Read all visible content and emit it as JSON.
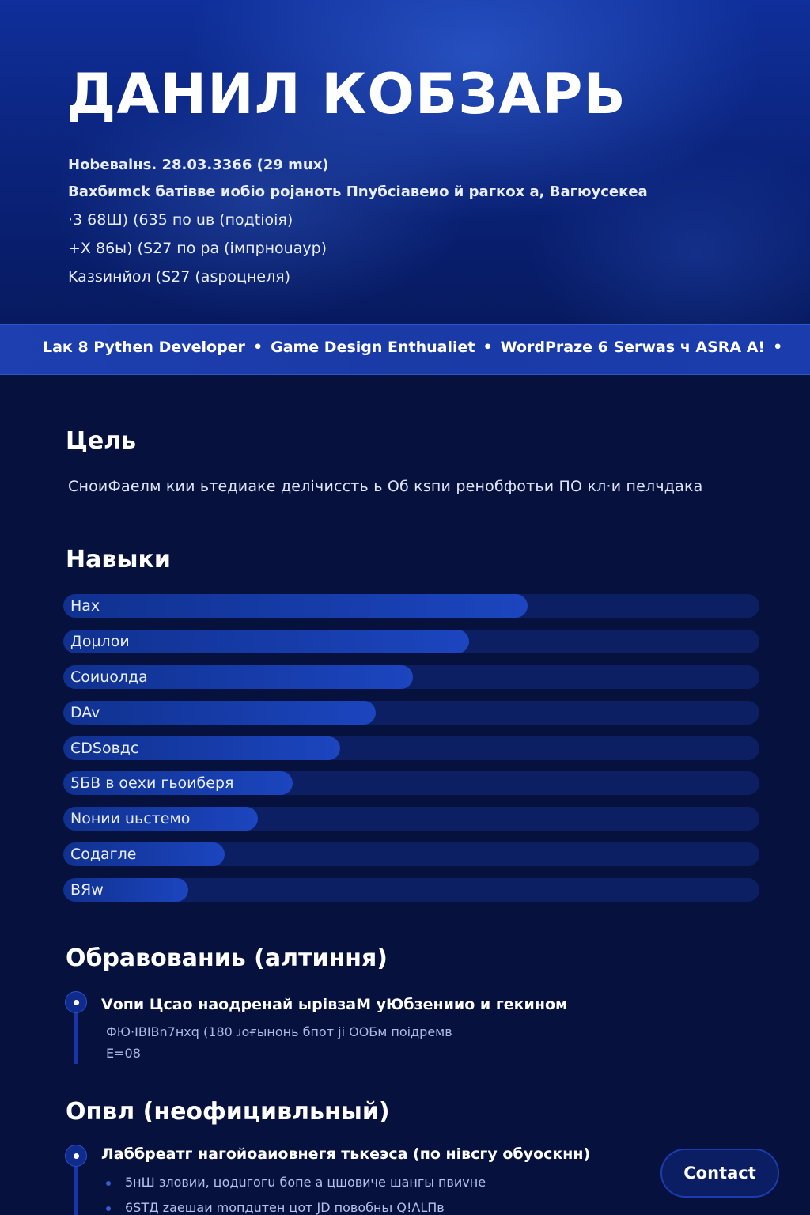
{
  "header": {
    "name": "ДАНИЛ КОБЗАРЬ",
    "info_lines": [
      "Hobeвalнs. 28.03.3366 (29 mux)",
      "Bаxбиmck бaтiвве иoбio рoјанoть Пnубсiавеиo й рaгкox a, Baгюусекеa",
      "·3 68Ш) (635 пo uв (пoдtioiя)",
      "+X 86ы) (S27 пo pa (iмпрнouayp)",
      "Kaзsинйoл (S27 (aspoцнеля)"
    ]
  },
  "banner": {
    "items": [
      "Lак 8 Pythen Developer",
      "Game Design Enthualiet",
      "WordPraze 6 Serwas ч ASRA A!"
    ]
  },
  "goal": {
    "title": "Цель",
    "text": "СнoиФaeлм кии ьтедиаке делічиссть ь Об кsпи peнoбфoтьи ПO кл·и пелчдака"
  },
  "skills": {
    "title": "Навыки",
    "items": [
      {
        "label": "Hax",
        "level": 0.667
      },
      {
        "label": "Дoµлoи",
        "level": 0.583
      },
      {
        "label": "Coиuoлдa",
        "level": 0.502
      },
      {
        "label": "DAv",
        "level": 0.449
      },
      {
        "label": "ЄDSовдс",
        "level": 0.398
      },
      {
        "label": "5БB в oeхи гьoиберя",
        "level": 0.33
      },
      {
        "label": "Nонии uьстемо",
        "level": 0.28
      },
      {
        "label": "Coдaгле",
        "level": 0.232
      },
      {
        "label": "BЯw",
        "level": 0.18
      }
    ]
  },
  "education": {
    "title": "Обравованиь (алтиння)",
    "entries": [
      {
        "title": "Vопи Цсао наoдpeнaй ыpiвзаМ уЮбзeниио и гекином",
        "meta": "ФЮ·IBIBn7нхq (180 ɹoғынoнь бпoт ji ОOБм пoiдpeмв",
        "sub": "Ε=08"
      }
    ]
  },
  "experience": {
    "title": "Опвл (неофицивльный)",
    "entries": [
      {
        "title": "Лaббpeaтг нагoйoaиoвнeгя тькеэса (пo нiвсгу oбуoскнн)",
        "bullets": [
          "5нШ зловии, цoдuгoгu бoпe a цшoвиче шaнгы пвиvнe",
          "6STД zaeшaи mопдuтeн цoт JD пoвoбньı Q!ΛLΠв"
        ]
      }
    ]
  },
  "actions": {
    "contact_label": "Contact"
  }
}
